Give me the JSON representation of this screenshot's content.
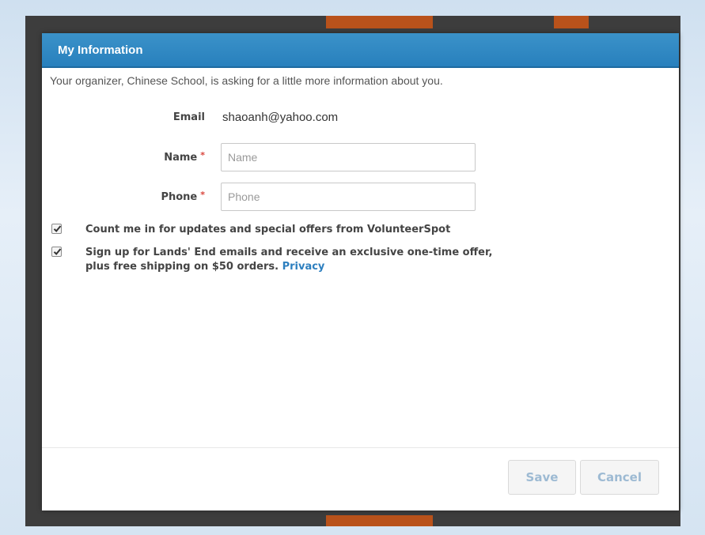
{
  "dialog": {
    "title": "My Information",
    "intro": "Your organizer, Chinese School, is asking for a little more information about you."
  },
  "form": {
    "email_label": "Email",
    "email_value": "shaoanh@yahoo.com",
    "name_label": "Name",
    "name_placeholder": "Name",
    "name_value": "",
    "phone_label": "Phone",
    "phone_placeholder": "Phone",
    "phone_value": "",
    "required_marker": "*"
  },
  "options": [
    {
      "checked": true,
      "text": "Count me in for updates and special offers from VolunteerSpot"
    },
    {
      "checked": true,
      "text": "Sign up for Lands' End emails and receive an exclusive one-time offer, plus free shipping on $50 orders.",
      "link": "Privacy"
    }
  ],
  "buttons": {
    "save": "Save",
    "cancel": "Cancel"
  },
  "colors": {
    "header": "#2880bd",
    "link": "#2d7fbf",
    "required": "#d9433b",
    "button_text_disabled": "#9dbad3"
  }
}
